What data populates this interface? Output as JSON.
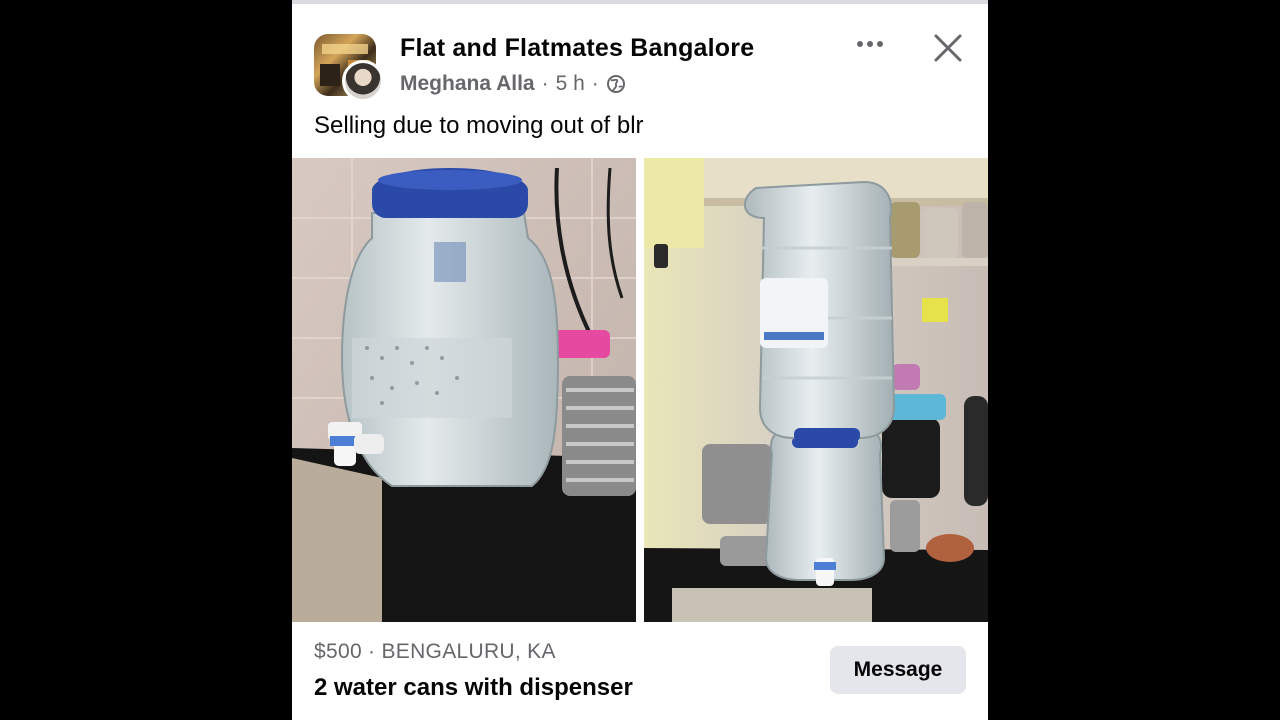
{
  "post": {
    "group_name": "Flat and Flatmates Bangalore",
    "author": "Meghana Alla",
    "separator": "·",
    "time": "5 h",
    "audience_icon": "globe-icon",
    "caption": "Selling due to moving out of blr"
  },
  "icons": {
    "more": "more-horizontal-icon",
    "close": "close-icon"
  },
  "photos": [
    {
      "subject": "water-jar-with-tap"
    },
    {
      "subject": "water-can-on-dispenser"
    }
  ],
  "listing": {
    "price_location": "$500 · BENGALURU, KA",
    "title": "2 water cans with dispenser",
    "message_label": "Message"
  },
  "colors": {
    "background": "#000000",
    "card": "#ffffff",
    "primary_text": "#050505",
    "secondary_text": "#65676b",
    "button_bg": "#e4e6eb",
    "jar_lid": "#2b4aa8"
  }
}
